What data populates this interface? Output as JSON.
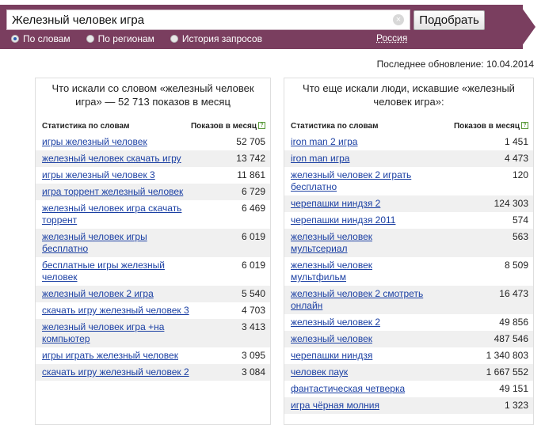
{
  "search": {
    "query": "Железный человек игра",
    "button_label": "Подобрать",
    "clear_symbol": "×"
  },
  "modes": [
    {
      "label": "По словам",
      "selected": true
    },
    {
      "label": "По регионам",
      "selected": false
    },
    {
      "label": "История запросов",
      "selected": false
    }
  ],
  "region": "Россия",
  "last_update": "Последнее обновление: 10.04.2014",
  "left_panel": {
    "title": "Что искали со словом «железный человек игра» — 52 713 показов в месяц",
    "col_phrase": "Статистика по словам",
    "col_count": "Показов в месяц",
    "help": "?",
    "rows": [
      {
        "phrase": "игры железный человек",
        "count": "52 705"
      },
      {
        "phrase": "железный человек скачать игру",
        "count": "13 742"
      },
      {
        "phrase": "игры железный человек 3",
        "count": "11 861"
      },
      {
        "phrase": "игра торрент железный человек",
        "count": "6 729"
      },
      {
        "phrase": "железный человек игра скачать торрент",
        "count": "6 469"
      },
      {
        "phrase": "железный человек игры бесплатно",
        "count": "6 019"
      },
      {
        "phrase": "бесплатные игры железный человек",
        "count": "6 019"
      },
      {
        "phrase": "железный человек 2 игра",
        "count": "5 540"
      },
      {
        "phrase": "скачать игру железный человек 3",
        "count": "4 703"
      },
      {
        "phrase": "железный человек игра +на компьютер",
        "count": "3 413"
      },
      {
        "phrase": "игры играть железный человек",
        "count": "3 095"
      },
      {
        "phrase": "скачать игру железный человек 2",
        "count": "3 084"
      }
    ]
  },
  "right_panel": {
    "title": "Что еще искали люди, искавшие «железный человек игра»:",
    "col_phrase": "Статистика по словам",
    "col_count": "Показов в месяц",
    "help": "?",
    "rows": [
      {
        "phrase": "iron man 2 игра",
        "count": "1 451"
      },
      {
        "phrase": "iron man игра",
        "count": "4 473"
      },
      {
        "phrase": "железный человек 2 играть бесплатно",
        "count": "120"
      },
      {
        "phrase": "черепашки ниндзя 2",
        "count": "124 303"
      },
      {
        "phrase": "черепашки ниндзя 2011",
        "count": "574"
      },
      {
        "phrase": "железный человек мультсериал",
        "count": "563"
      },
      {
        "phrase": "железный человек мультфильм",
        "count": "8 509"
      },
      {
        "phrase": "железный человек 2 смотреть онлайн",
        "count": "16 473"
      },
      {
        "phrase": "железный человек 2",
        "count": "49 856"
      },
      {
        "phrase": "железный человек",
        "count": "487 546"
      },
      {
        "phrase": "черепашки ниндзя",
        "count": "1 340 803"
      },
      {
        "phrase": "человек паук",
        "count": "1 667 552"
      },
      {
        "phrase": "фантастическая четверка",
        "count": "49 151"
      },
      {
        "phrase": "игра чёрная молния",
        "count": "1 323"
      }
    ]
  }
}
